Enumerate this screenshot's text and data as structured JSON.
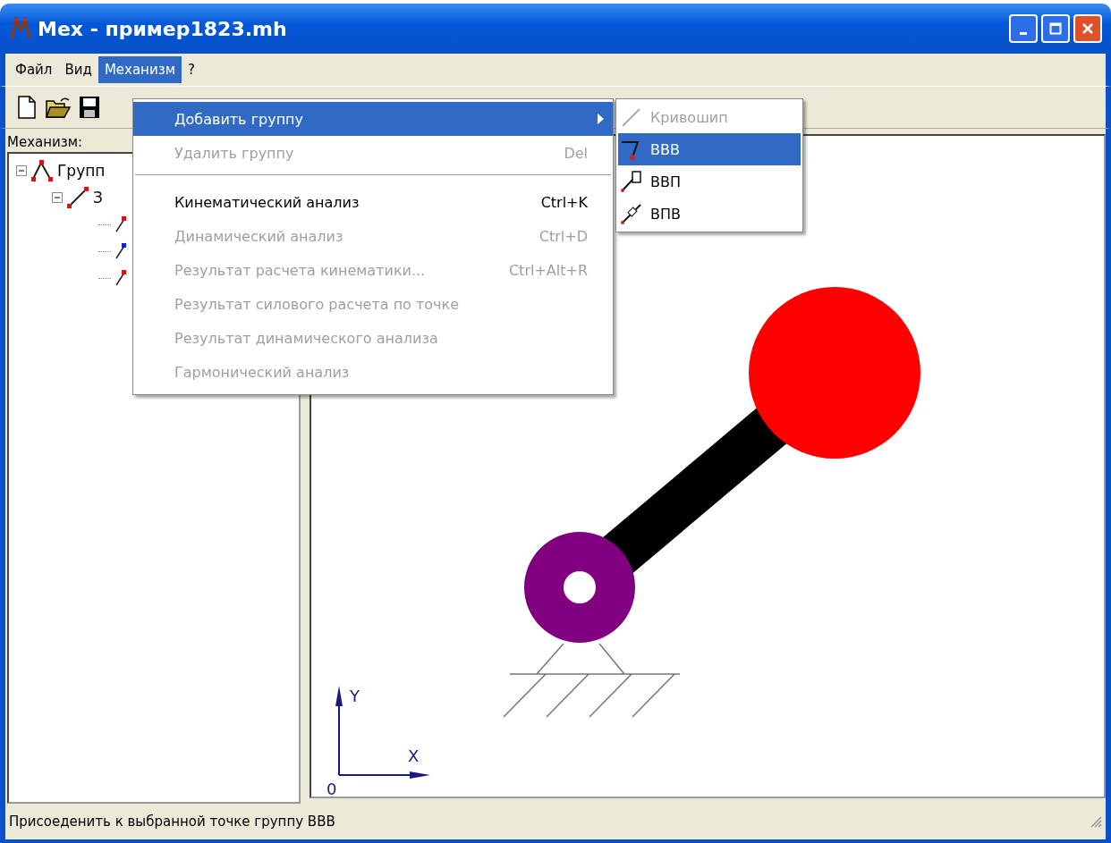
{
  "window": {
    "title": "Мех - пример1823.mh"
  },
  "menubar": [
    {
      "label": "Файл",
      "selected": false
    },
    {
      "label": "Вид",
      "selected": false
    },
    {
      "label": "Механизм",
      "selected": true
    },
    {
      "label": "?",
      "selected": false
    }
  ],
  "toolbar": [
    {
      "kind": "new"
    },
    {
      "kind": "open"
    },
    {
      "kind": "save"
    }
  ],
  "panel": {
    "label": "Механизм:",
    "tree": [
      {
        "label": "Групп",
        "kind": "group",
        "expanded": true,
        "children": [
          {
            "label": "З",
            "kind": "link",
            "expanded": true,
            "children": [
              {
                "kind": "joint",
                "color": "#e01010"
              },
              {
                "kind": "joint",
                "color": "#1020e0"
              },
              {
                "kind": "joint",
                "color": "#e01010"
              }
            ]
          }
        ]
      }
    ]
  },
  "menu": {
    "items": [
      {
        "kind": "item",
        "label": "Добавить группу",
        "submenu": true,
        "selected": true,
        "disabled": false
      },
      {
        "kind": "item",
        "label": "Удалить группу",
        "shortcut": "Del",
        "selected": false,
        "disabled": true
      },
      {
        "kind": "separator"
      },
      {
        "kind": "item",
        "label": "Кинематический анализ",
        "shortcut": "Ctrl+K",
        "selected": false,
        "disabled": false
      },
      {
        "kind": "item",
        "label": "Динамический анализ",
        "shortcut": "Ctrl+D",
        "selected": false,
        "disabled": true
      },
      {
        "kind": "item",
        "label": "Результат расчета кинематики...",
        "shortcut": "Ctrl+Alt+R",
        "selected": false,
        "disabled": true
      },
      {
        "kind": "item",
        "label": "Результат силового расчета по точке",
        "selected": false,
        "disabled": true
      },
      {
        "kind": "item",
        "label": "Результат динамического анализа",
        "selected": false,
        "disabled": true
      },
      {
        "kind": "item",
        "label": "Гармонический анализ",
        "selected": false,
        "disabled": true
      }
    ]
  },
  "submenu": {
    "items": [
      {
        "kind": "crank",
        "label": "Кривошип",
        "selected": false,
        "disabled": true
      },
      {
        "kind": "rrr",
        "label": "ВВВ",
        "selected": true,
        "disabled": false
      },
      {
        "kind": "rrp",
        "label": "ВВП",
        "selected": false,
        "disabled": false
      },
      {
        "kind": "rpr",
        "label": "ВПВ",
        "selected": false,
        "disabled": false
      }
    ]
  },
  "canvas": {
    "axes": {
      "y": "Y",
      "x": "X",
      "origin": "0"
    }
  },
  "status_bar": "Присоеденить к выбранной точке группу ВВВ"
}
